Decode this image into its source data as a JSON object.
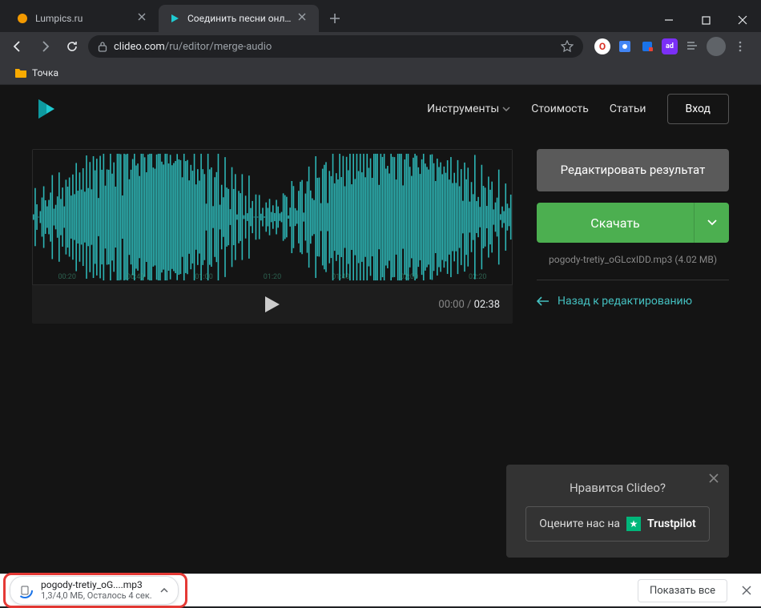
{
  "browser": {
    "tabs": [
      {
        "title": "Lumpics.ru",
        "active": false
      },
      {
        "title": "Соединить песни онлайн — Со...",
        "active": true
      }
    ],
    "url_host": "clideo.com",
    "url_path": "/ru/editor/merge-audio",
    "bookmark": "Точка"
  },
  "site_nav": {
    "tools": "Инструменты",
    "pricing": "Стоимость",
    "articles": "Статьи",
    "login": "Вход"
  },
  "player": {
    "current_time": "00:00",
    "total_time": "02:38",
    "marks": [
      "00:20",
      "00:40",
      "01:00",
      "01:20",
      "01:40",
      "02:00",
      "02:20"
    ]
  },
  "actions": {
    "edit_result": "Редактировать результат",
    "download": "Скачать",
    "file_info": "pogody-tretiy_oGLcxIDD.mp3  (4.02 MB)",
    "back": "Назад к редактированию"
  },
  "trust": {
    "title": "Нравится Clideo?",
    "rate_prefix": "Оцените нас на",
    "provider": "Trustpilot"
  },
  "download_bar": {
    "file": "pogody-tretiy_oG....mp3",
    "status": "1,3/4,0 МБ, Осталось 4 сек.",
    "show_all": "Показать все"
  }
}
